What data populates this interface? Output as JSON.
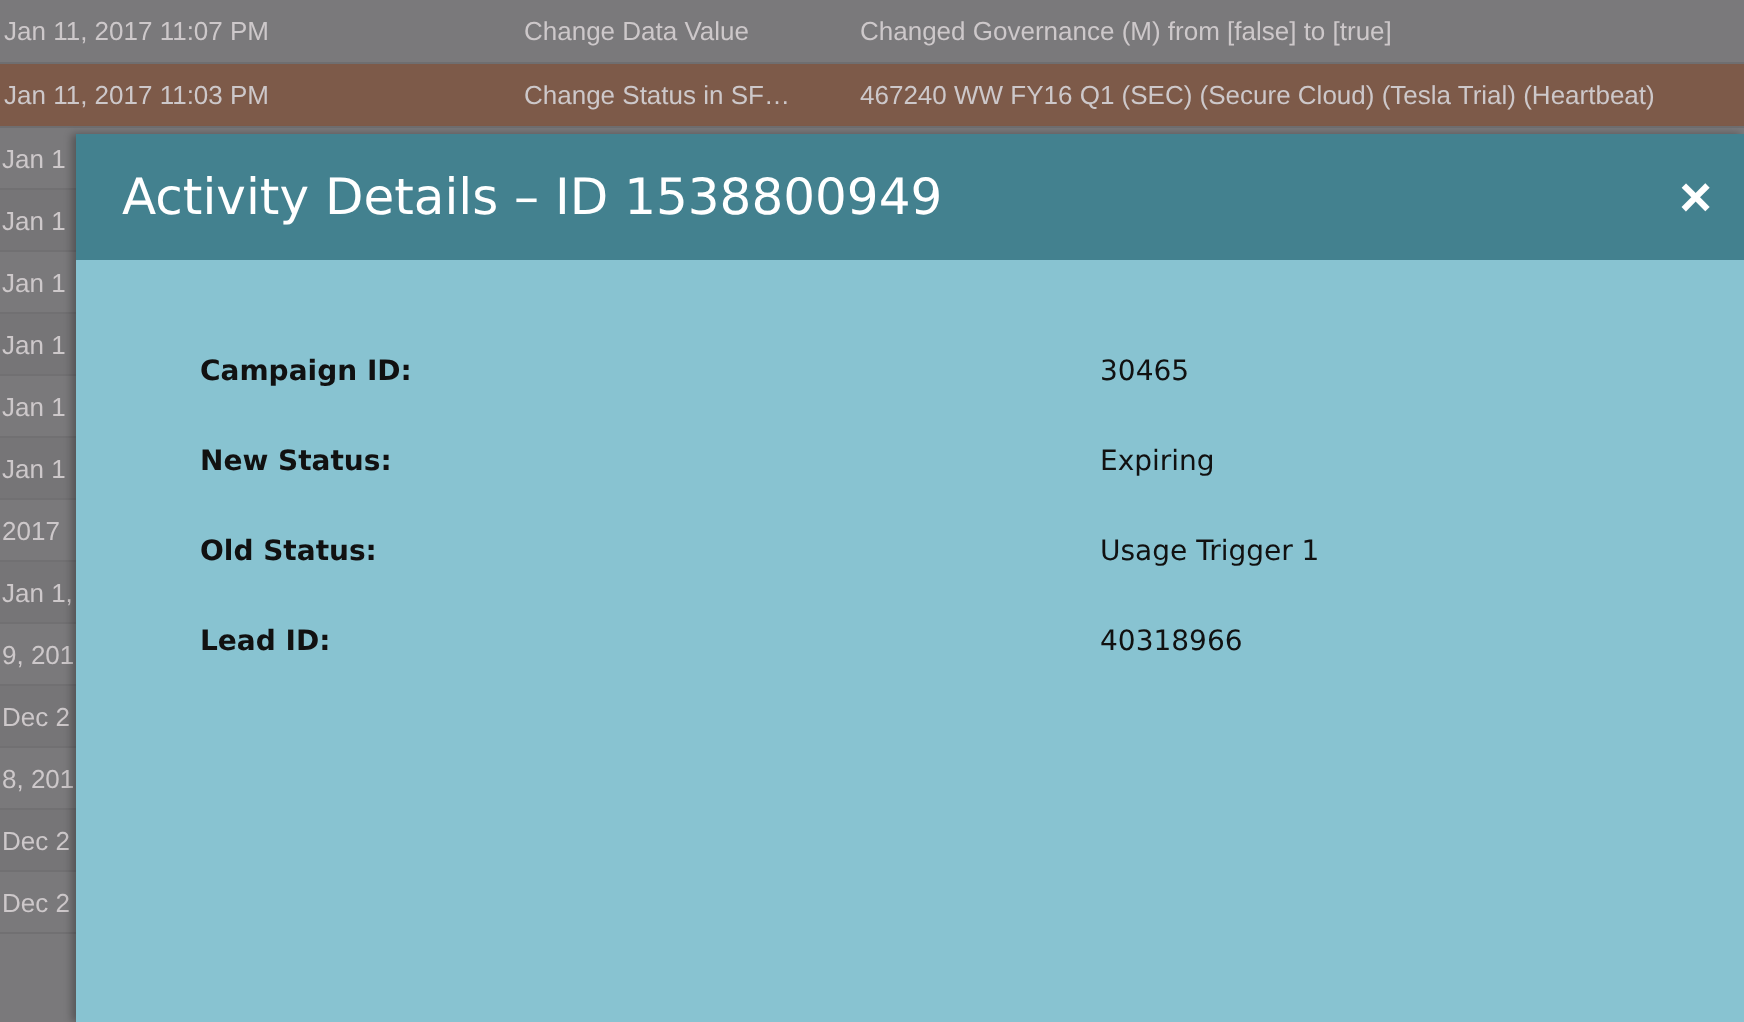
{
  "activity_rows": [
    {
      "date": "Jan 11, 2017 11:07 PM",
      "type": "Change Data Value",
      "detail": "Changed Governance (M) from [false] to [true]",
      "selected": false
    },
    {
      "date": "Jan 11, 2017 11:03 PM",
      "type": "Change Status in SF…",
      "detail": "467240 WW FY16 Q1 (SEC) (Secure Cloud) (Tesla Trial) (Heartbeat)",
      "selected": true
    }
  ],
  "hidden_rows": [
    "Jan 1",
    "Jan 1",
    "Jan 1",
    "Jan 1",
    "Jan 1",
    "Jan 1",
    "2017",
    "Jan 1,",
    "9, 201",
    "Dec 2",
    "8, 201",
    "Dec 2",
    "Dec 2"
  ],
  "dialog": {
    "title": "Activity Details – ID 1538800949",
    "close": "×",
    "fields": [
      {
        "label": "Campaign ID:",
        "value": "30465"
      },
      {
        "label": "New Status:",
        "value": "Expiring"
      },
      {
        "label": "Old Status:",
        "value": "Usage Trigger 1"
      },
      {
        "label": "Lead ID:",
        "value": "40318966"
      }
    ]
  }
}
